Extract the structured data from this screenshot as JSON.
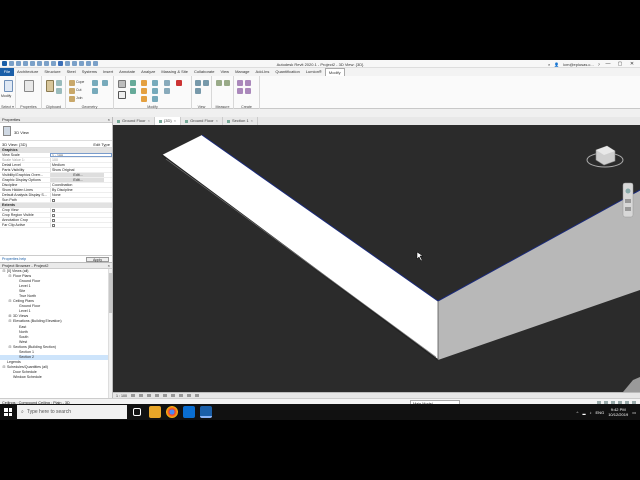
{
  "app": {
    "title": "Autodesk Revit 2020.1 - Project2 - 3D View: {3D}",
    "user": "lcm@eplusas.c...",
    "colors": {
      "file_tab": "#1b5fa8",
      "viewport_bg": "#2b2b2b",
      "selection_edge": "#1a2a7a"
    }
  },
  "menu": {
    "file": "File",
    "tabs": [
      "Architecture",
      "Structure",
      "Steel",
      "Systems",
      "Insert",
      "Annotate",
      "Analyze",
      "Massing & Site",
      "Collaborate",
      "View",
      "Manage",
      "Add-Ins",
      "Quantification",
      "Lumion®",
      "Modify"
    ],
    "active_index": 14
  },
  "ribbon": {
    "groups": [
      "Select",
      "Properties",
      "Clipboard",
      "Geometry",
      "Modify",
      "View",
      "Measure",
      "Create"
    ],
    "modify_label": "Modify",
    "select_label": "Select ▾",
    "clipboard": [
      "Paste",
      "Cope",
      "Cut",
      "Join"
    ],
    "clipboard_icons": [
      "cut-icon",
      "copy-icon",
      "paste-icon"
    ]
  },
  "view_tabs": [
    {
      "label": "Ground Floor",
      "active": false
    },
    {
      "label": "{3D}",
      "active": true
    },
    {
      "label": "Ground Floor",
      "active": false
    },
    {
      "label": "Section 1",
      "active": false
    }
  ],
  "properties": {
    "title": "Properties",
    "close": "×",
    "type_name": "3D View",
    "filter": "3D View: {3D}",
    "edit_type": "Edit Type",
    "groups": {
      "graphics": "Graphics",
      "extents": "Extents"
    },
    "rows": [
      {
        "k": "View Scale",
        "v": "1 : 100",
        "input": true
      },
      {
        "k": "Scale Value    1:",
        "v": "100",
        "dim": true
      },
      {
        "k": "Detail Level",
        "v": "Medium"
      },
      {
        "k": "Parts Visibility",
        "v": "Show Original"
      },
      {
        "k": "Visibility/Graphics Overr...",
        "v": "Edit...",
        "btn": true
      },
      {
        "k": "Graphic Display Options",
        "v": "Edit...",
        "btn": true
      },
      {
        "k": "Discipline",
        "v": "Coordination"
      },
      {
        "k": "Show Hidden Lines",
        "v": "By Discipline"
      },
      {
        "k": "Default Analysis Display S...",
        "v": "None"
      },
      {
        "k": "Sun Path",
        "v": "",
        "chk": true
      }
    ],
    "extents_rows": [
      {
        "k": "Crop View",
        "v": "",
        "chk": true
      },
      {
        "k": "Crop Region Visible",
        "v": "",
        "chk": true
      },
      {
        "k": "Annotation Crop",
        "v": "",
        "chk": true
      },
      {
        "k": "Far Clip Active",
        "v": "",
        "chk": true
      }
    ],
    "help": "Properties help",
    "apply": "Apply"
  },
  "browser": {
    "title": "Project Browser - Project2",
    "close": "×",
    "nodes": [
      {
        "d": 0,
        "t": "⊟",
        "label": "[0] Views (all)"
      },
      {
        "d": 1,
        "t": "⊟",
        "label": "Floor Plans"
      },
      {
        "d": 2,
        "t": "",
        "label": "Ground Floor"
      },
      {
        "d": 2,
        "t": "",
        "label": "Level 1"
      },
      {
        "d": 2,
        "t": "",
        "label": "Site"
      },
      {
        "d": 2,
        "t": "",
        "label": "True North"
      },
      {
        "d": 1,
        "t": "⊟",
        "label": "Ceiling Plans"
      },
      {
        "d": 2,
        "t": "",
        "label": "Ground Floor"
      },
      {
        "d": 2,
        "t": "",
        "label": "Level 1"
      },
      {
        "d": 1,
        "t": "⊞",
        "label": "3D Views"
      },
      {
        "d": 1,
        "t": "⊟",
        "label": "Elevations (Building Elevation)"
      },
      {
        "d": 2,
        "t": "",
        "label": "East"
      },
      {
        "d": 2,
        "t": "",
        "label": "North"
      },
      {
        "d": 2,
        "t": "",
        "label": "South"
      },
      {
        "d": 2,
        "t": "",
        "label": "West"
      },
      {
        "d": 1,
        "t": "⊟",
        "label": "Sections (Building Section)"
      },
      {
        "d": 2,
        "t": "",
        "label": "Section 1"
      },
      {
        "d": 2,
        "t": "",
        "label": "Section 2",
        "sel": true
      },
      {
        "d": 0,
        "t": "",
        "label": "Legends"
      },
      {
        "d": 0,
        "t": "⊟",
        "label": "Schedules/Quantities (all)"
      },
      {
        "d": 1,
        "t": "",
        "label": "Door Schedule"
      },
      {
        "d": 1,
        "t": "",
        "label": "Window Schedule"
      }
    ]
  },
  "viewbar": {
    "scale": "1 : 100"
  },
  "status": {
    "message": "Ceilings : Compound Ceiling : Plain - 3D",
    "model": "Main Model"
  },
  "taskbar": {
    "search_placeholder": "Type here to search",
    "lang": "ENG",
    "time": "9:42 PM",
    "date": "10/12/2019"
  }
}
